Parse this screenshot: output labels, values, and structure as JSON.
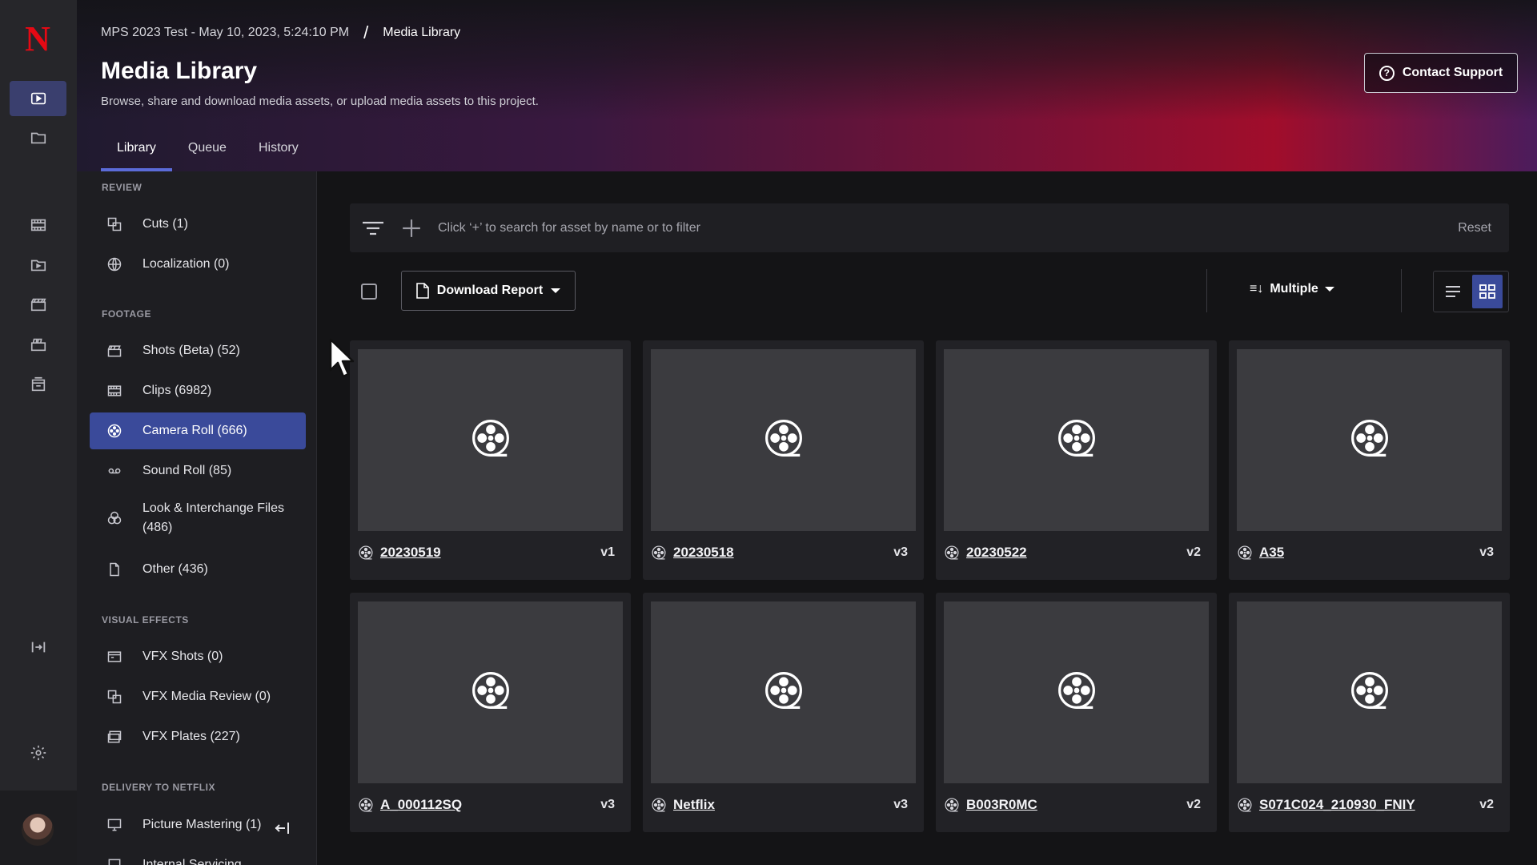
{
  "rail": {
    "logo": "N",
    "items": [
      {
        "icon": "media-library-icon",
        "active": true
      },
      {
        "icon": "folder-icon"
      },
      {
        "icon": "film-strip-icon"
      },
      {
        "icon": "play-folder-icon"
      },
      {
        "icon": "slate-icon"
      },
      {
        "icon": "clapper-icon"
      },
      {
        "icon": "archive-icon"
      },
      {
        "icon": "expand-sidebar-icon"
      },
      {
        "icon": "gear-icon"
      }
    ]
  },
  "header": {
    "breadcrumb_project": "MPS 2023 Test - May 10, 2023, 5:24:10 PM",
    "breadcrumb_sep": "/",
    "breadcrumb_current": "Media Library",
    "title": "Media Library",
    "subtitle": "Browse, share and download media assets, or upload media assets to this project.",
    "support_label": "Contact Support",
    "support_icon_glyph": "?",
    "tabs": [
      {
        "label": "Library",
        "active": true
      },
      {
        "label": "Queue"
      },
      {
        "label": "History"
      }
    ]
  },
  "sidebar": {
    "review_label": "REVIEW",
    "footage_label": "FOOTAGE",
    "vfx_label": "VISUAL EFFECTS",
    "delivery_label": "DELIVERY TO NETFLIX",
    "items": [
      {
        "label": "Cuts (1)",
        "icon": "cuts-icon"
      },
      {
        "label": "Localization (0)",
        "icon": "globe-icon"
      },
      {
        "label": "Shots (Beta) (52)",
        "icon": "clapperboard-icon"
      },
      {
        "label": "Clips (6982)",
        "icon": "film-strip-icon"
      },
      {
        "label": "Camera Roll (666)",
        "icon": "film-reel-icon",
        "active": true
      },
      {
        "label": "Sound Roll (85)",
        "icon": "tape-icon"
      },
      {
        "label": "Look & Interchange Files (486)",
        "icon": "color-circles-icon"
      },
      {
        "label": "Other (436)",
        "icon": "document-icon"
      },
      {
        "label": "VFX Shots (0)",
        "icon": "vfx-shots-icon"
      },
      {
        "label": "VFX Media Review (0)",
        "icon": "vfx-review-icon"
      },
      {
        "label": "VFX Plates (227)",
        "icon": "vfx-plates-icon"
      },
      {
        "label": "Picture Mastering (1)",
        "icon": "monitor-icon"
      },
      {
        "label": "Internal Servicing",
        "icon": "servicing-icon"
      }
    ]
  },
  "toolbar": {
    "search_placeholder": "Click ‘+’ to search for asset by name or to filter",
    "reset_label": "Reset",
    "download_label": "Download Report",
    "sort_label": "Multiple",
    "sort_icon_glyph": "≡↓"
  },
  "assets": [
    {
      "name": "20230519",
      "version": "v1"
    },
    {
      "name": "20230518",
      "version": "v3"
    },
    {
      "name": "20230522",
      "version": "v2"
    },
    {
      "name": "A35",
      "version": "v3"
    },
    {
      "name": "A_000112SQ",
      "version": "v3"
    },
    {
      "name": "Netflix",
      "version": "v3"
    },
    {
      "name": "B003R0MC",
      "version": "v2"
    },
    {
      "name": "S071C024_210930_FNIY",
      "version": "v2"
    }
  ],
  "colors": {
    "accent": "#3a4a9a",
    "brand": "#e50914"
  }
}
